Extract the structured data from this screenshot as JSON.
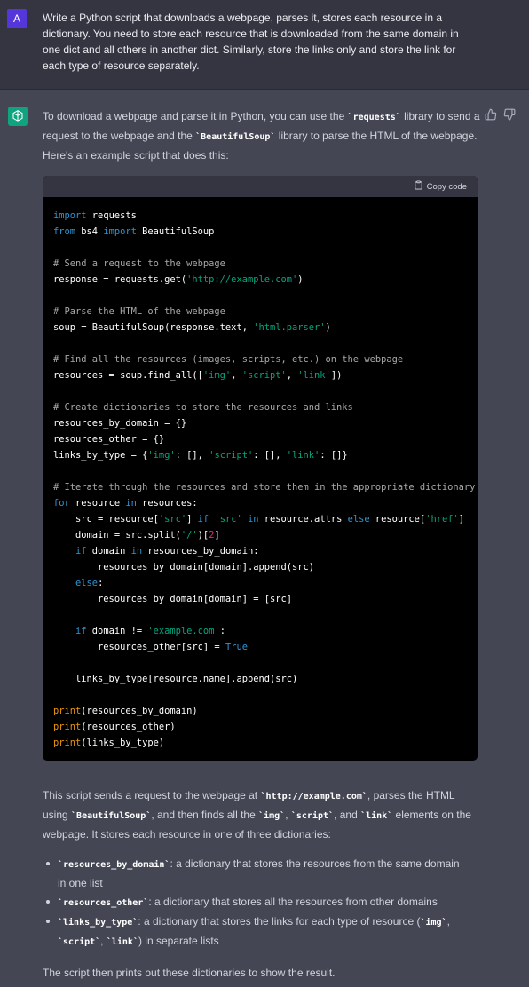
{
  "user_message": {
    "avatar_letter": "A",
    "text": "Write a Python script that downloads a webpage, parses it, stores each resource in a dictionary. You need to store each resource that is downloaded from the same domain in one dict and all others in another dict. Similarly, store the links only and store the link for each type of resource separately."
  },
  "assistant_message": {
    "intro_1": "To download a webpage and parse it in Python, you can use the ",
    "intro_code_1": "`requests`",
    "intro_2": " library to send a request to the webpage and the ",
    "intro_code_2": "`BeautifulSoup`",
    "intro_3": " library to parse the HTML of the webpage. Here's an example script that does this:",
    "copy_label": "Copy code",
    "code_lines": [
      "import requests",
      "from bs4 import BeautifulSoup",
      "",
      "# Send a request to the webpage",
      "response = requests.get('http://example.com')",
      "",
      "# Parse the HTML of the webpage",
      "soup = BeautifulSoup(response.text, 'html.parser')",
      "",
      "# Find all the resources (images, scripts, etc.) on the webpage",
      "resources = soup.find_all(['img', 'script', 'link'])",
      "",
      "# Create dictionaries to store the resources and links",
      "resources_by_domain = {}",
      "resources_other = {}",
      "links_by_type = {'img': [], 'script': [], 'link': []}",
      "",
      "# Iterate through the resources and store them in the appropriate dictionary",
      "for resource in resources:",
      "    src = resource['src'] if 'src' in resource.attrs else resource['href']",
      "    domain = src.split('/')[2]",
      "    if domain in resources_by_domain:",
      "        resources_by_domain[domain].append(src)",
      "    else:",
      "        resources_by_domain[domain] = [src]",
      "",
      "    if domain != 'example.com':",
      "        resources_other[src] = True",
      "",
      "    links_by_type[resource.name].append(src)",
      "",
      "print(resources_by_domain)",
      "print(resources_other)",
      "print(links_by_type)"
    ],
    "outro_1": "This script sends a request to the webpage at ",
    "outro_code_1": "`http://example.com`",
    "outro_2": ", parses the HTML using ",
    "outro_code_2": "`BeautifulSoup`",
    "outro_3": ", and then finds all the ",
    "outro_code_3": "`img`",
    "outro_4": ", ",
    "outro_code_4": "`script`",
    "outro_5": ", and ",
    "outro_code_5": "`link`",
    "outro_6": " elements on the webpage. It stores each resource in one of three dictionaries:",
    "bullets": [
      {
        "code": "`resources_by_domain`",
        "text": ": a dictionary that stores the resources from the same domain in one list"
      },
      {
        "code": "`resources_other`",
        "text": ": a dictionary that stores all the resources from other domains"
      },
      {
        "code": "`links_by_type`",
        "text": ": a dictionary that stores the links for each type of resource (",
        "code_b": "`img`",
        "text_b": ", ",
        "code_c": "`script`",
        "text_c": ", ",
        "code_d": "`link`",
        "text_d": ") in separate lists"
      }
    ],
    "closing": "The script then prints out these dictionaries to show the result."
  },
  "colors": {
    "user_bg": "#343541",
    "assistant_bg": "#444654",
    "user_avatar": "#5436da",
    "bot_avatar": "#10a37f",
    "code_bg": "#000000"
  },
  "icons": [
    "openai-logo-icon",
    "thumbs-up-icon",
    "thumbs-down-icon",
    "clipboard-icon"
  ]
}
